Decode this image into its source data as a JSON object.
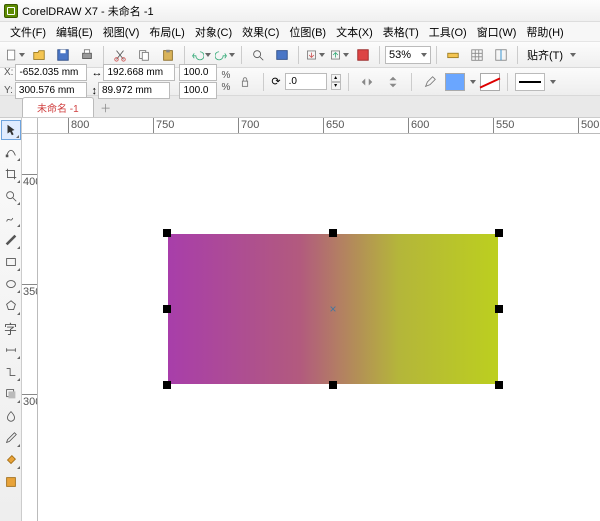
{
  "title": "CorelDRAW X7 - 未命名 -1",
  "menus": [
    "文件(F)",
    "编辑(E)",
    "视图(V)",
    "布局(L)",
    "对象(C)",
    "效果(C)",
    "位图(B)",
    "文本(X)",
    "表格(T)",
    "工具(O)",
    "窗口(W)",
    "帮助(H)"
  ],
  "toolbar": {
    "zoom": "53%",
    "paste_label": "贴齐(T)"
  },
  "props": {
    "x_label": "X:",
    "x": "-652.035 mm",
    "y_label": "Y:",
    "y": "300.576 mm",
    "w": "192.668 mm",
    "h": "89.972 mm",
    "sx": "100.0",
    "sy": "100.0",
    "pct": "%",
    "rot": ".0"
  },
  "doc_tab": "未命名 -1",
  "ruler_h": [
    "800",
    "750",
    "700",
    "650",
    "600",
    "550",
    "500"
  ],
  "ruler_v": [
    "400",
    "350",
    "300"
  ]
}
